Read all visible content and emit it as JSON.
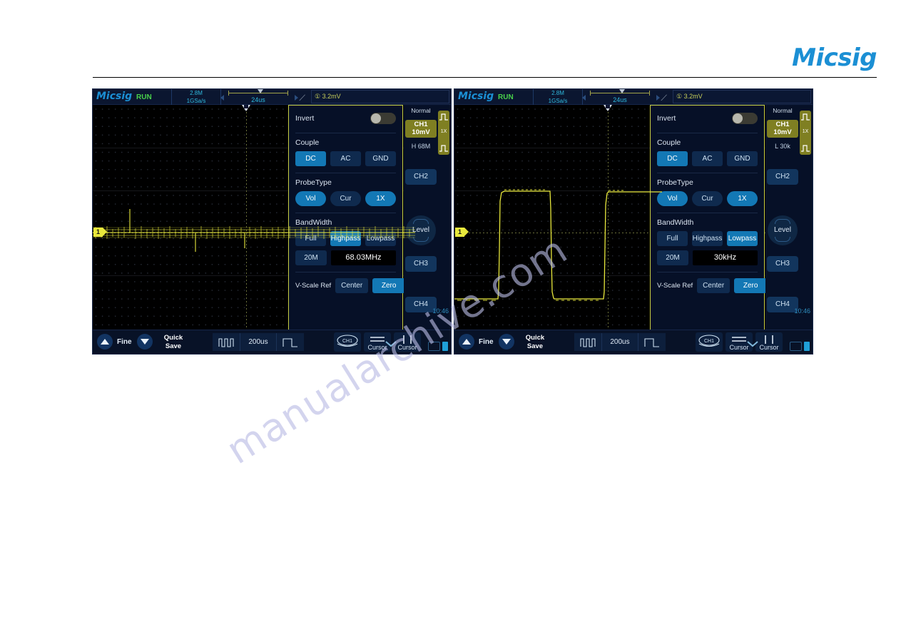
{
  "page": {
    "brand": "Micsig",
    "watermark": "manualarchive.com"
  },
  "scopes": [
    {
      "id": "left",
      "statusbar": {
        "logo": "Micsig",
        "run_state": "RUN",
        "memory_depth": "2.8M",
        "sample_rate": "1GSa/s",
        "timebase": "24us",
        "slope_icon": "rising-edge-icon",
        "trigger_source": "①",
        "trigger_level": "3.2mV"
      },
      "channel_marker": "1",
      "panel": {
        "invert_label": "Invert",
        "invert_on": false,
        "couple_label": "Couple",
        "couple_options": [
          "DC",
          "AC",
          "GND"
        ],
        "couple_selected": "DC",
        "probetype_label": "ProbeType",
        "probetype_options": [
          "Vol",
          "Cur",
          "1X"
        ],
        "probetype_selected": [
          "Vol",
          "1X"
        ],
        "bandwidth_label": "BandWidth",
        "bandwidth_options": [
          "Full",
          "Highpass",
          "Lowpass"
        ],
        "bandwidth_selected": "Highpass",
        "bandwidth_row2": "20M",
        "bandwidth_value": "68.03MHz",
        "vscale_label": "V-Scale Ref",
        "vscale_options": [
          "Center",
          "Zero"
        ],
        "vscale_selected": "Zero"
      },
      "rail": {
        "trigger_mode": "Normal",
        "ch1_name": "CH1",
        "ch1_scale": "10mV",
        "ch1_filter": "H 68M",
        "probe_ratio": "1X",
        "channels": [
          "CH2",
          "CH3",
          "CH4"
        ],
        "level_label": "Level",
        "clock": "10:46"
      },
      "toolbar": {
        "fine_label": "Fine",
        "quick_save_line1": "Quick",
        "quick_save_line2": "Save",
        "timebase_value": "200us",
        "ch_chip": "CH1",
        "cursor_h_label": "Cursor",
        "cursor_v_label": "Cursor"
      }
    },
    {
      "id": "right",
      "statusbar": {
        "logo": "Micsig",
        "run_state": "RUN",
        "memory_depth": "2.8M",
        "sample_rate": "1GSa/s",
        "timebase": "24us",
        "slope_icon": "rising-edge-icon",
        "trigger_source": "①",
        "trigger_level": "3.2mV"
      },
      "channel_marker": "1",
      "panel": {
        "invert_label": "Invert",
        "invert_on": false,
        "couple_label": "Couple",
        "couple_options": [
          "DC",
          "AC",
          "GND"
        ],
        "couple_selected": "DC",
        "probetype_label": "ProbeType",
        "probetype_options": [
          "Vol",
          "Cur",
          "1X"
        ],
        "probetype_selected": [
          "Vol",
          "1X"
        ],
        "bandwidth_label": "BandWidth",
        "bandwidth_options": [
          "Full",
          "Highpass",
          "Lowpass"
        ],
        "bandwidth_selected": "Lowpass",
        "bandwidth_row2": "20M",
        "bandwidth_value": "30kHz",
        "vscale_label": "V-Scale Ref",
        "vscale_options": [
          "Center",
          "Zero"
        ],
        "vscale_selected": "Zero"
      },
      "rail": {
        "trigger_mode": "Normal",
        "ch1_name": "CH1",
        "ch1_scale": "10mV",
        "ch1_filter": "L 30k",
        "probe_ratio": "1X",
        "channels": [
          "CH2",
          "CH3",
          "CH4"
        ],
        "level_label": "Level",
        "clock": "10:46"
      },
      "toolbar": {
        "fine_label": "Fine",
        "quick_save_line1": "Quick",
        "quick_save_line2": "Save",
        "timebase_value": "200us",
        "ch_chip": "CH1",
        "cursor_h_label": "Cursor",
        "cursor_v_label": "Cursor"
      }
    }
  ]
}
